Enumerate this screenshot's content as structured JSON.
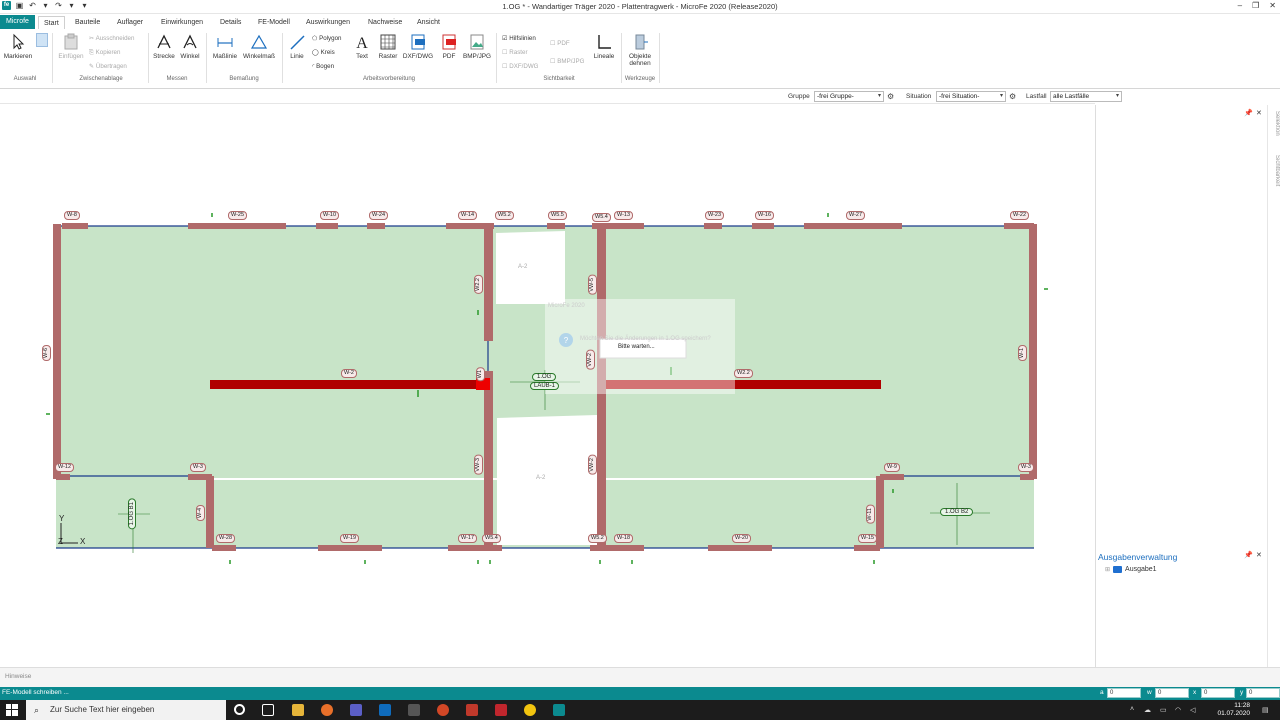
{
  "titlebar": {
    "title": "1.OG * - Wandartiger Träger 2020 - Plattentragwerk - MicroFe 2020  (Release2020)",
    "window_buttons": [
      "–",
      "❐",
      "✕"
    ]
  },
  "tabs": {
    "file": "Microfe",
    "items": [
      {
        "label": "Start",
        "active": true
      },
      {
        "label": "Bauteile"
      },
      {
        "label": "Auflager"
      },
      {
        "label": "Einwirkungen"
      },
      {
        "label": "Details"
      },
      {
        "label": "FE-Modell"
      },
      {
        "label": "Auswirkungen"
      },
      {
        "label": "Nachweise"
      },
      {
        "label": "Ansicht"
      }
    ]
  },
  "ribbon": {
    "markieren": "Markieren",
    "einfuegen": "Einfügen",
    "ausschneiden": "Ausschneiden",
    "kopieren": "Kopieren",
    "uebertragen": "Übertragen",
    "strecke": "Strecke",
    "winkel": "Winkel",
    "masslinie": "Maßlinie",
    "winkelmass": "Winkelmaß",
    "linie": "Linie",
    "polygon": "Polygon",
    "kreis": "Kreis",
    "bogen": "Bogen",
    "text": "Text",
    "raster": "Raster",
    "dxf": "DXF/DWG",
    "pdf": "PDF",
    "bmp": "BMP/JPG",
    "hilfslinien": "Hilfslinien",
    "raster2": "Raster",
    "dxf2": "DXF/DWG",
    "pdf2": "PDF",
    "bmp2": "BMP/JPG",
    "lineale": "Lineale",
    "objekte": "Objekte dehnen",
    "groups": {
      "auswahl": "Auswahl",
      "zwischenablage": "Zwischenablage",
      "messen": "Messen",
      "bemassung": "Bemaßung",
      "arbeitsvorbereitung": "Arbeitsvorbereitung",
      "sichtbarkeit": "Sichtbarkeit",
      "werkzeuge": "Werkzeuge"
    }
  },
  "filterbar": {
    "gruppe_label": "Gruppe",
    "gruppe_value": "-frei Gruppe-",
    "situation_label": "Situation",
    "situation_value": "-frei Situation-",
    "lastfall_label": "Lastfall",
    "lastfall_value": "alle Lastfälle"
  },
  "canvas": {
    "wall_labels": [
      "W-8",
      "W-25",
      "W-10",
      "W-24",
      "W-14",
      "W5.2",
      "W5.5",
      "W5.4",
      "W-13",
      "W-23",
      "W-16",
      "W-27",
      "W-22",
      "W-6",
      "W-1",
      "W-12",
      "W-3",
      "W-4",
      "W-28",
      "W-19",
      "W-17",
      "W5.4",
      "W5.2",
      "W-18",
      "W-20",
      "W-15",
      "W-11",
      "W-9",
      "W-3",
      "W-2",
      "W2.2",
      "W2.2",
      "VW-3",
      "VW-5",
      "VW-2",
      "VW-2",
      "W1"
    ],
    "area_labels": {
      "a1": "A-2",
      "a2": "A-2",
      "og": "1.OG",
      "lauf": "LAUB-1",
      "ogb1": "1.OG B1",
      "ogb2": "1.OG B2"
    },
    "axis_y": "Y",
    "axis_z": "Z",
    "axis_x": "X"
  },
  "dialog": {
    "title": "MicroFe 2020",
    "question": "Möchten Sie die Änderungen in 1.OG speichern?",
    "wait": "Bitte warten..."
  },
  "rightpane": {
    "vtabs": [
      "Selektion",
      "Sichtbarkeit"
    ],
    "output_title": "Ausgabenverwaltung",
    "output_item": "Ausgabe1"
  },
  "hinweise": "Hinweise",
  "status": {
    "message": "FE-Modell schreiben ...",
    "fields": [
      {
        "label": "a",
        "value": "0"
      },
      {
        "label": "w",
        "value": "0"
      },
      {
        "label": "x",
        "value": "0"
      },
      {
        "label": "y",
        "value": "0"
      }
    ]
  },
  "taskbar": {
    "search_placeholder": "Zur Suche Text hier eingeben",
    "time": "11:28",
    "date": "01.07.2020"
  },
  "colors": {
    "accent": "#0b8a8f",
    "slab": "#c8e4c8",
    "wall": "#b06a6a",
    "beam": "#b00000",
    "link": "#1d6fbf"
  }
}
